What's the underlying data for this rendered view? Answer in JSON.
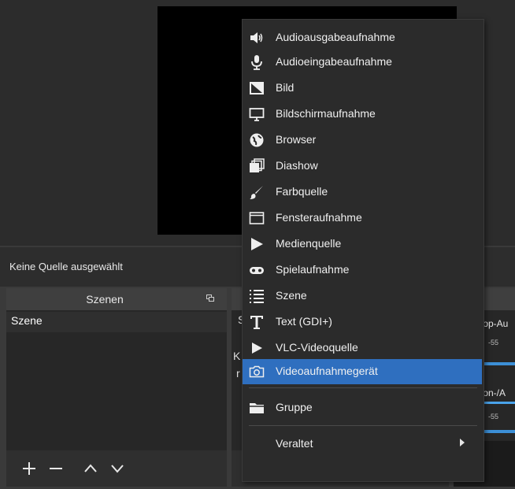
{
  "status": {
    "no_source_selected": "Keine Quelle ausgewählt"
  },
  "scenes": {
    "title": "Szenen",
    "items": [
      "Szene"
    ]
  },
  "sources": {
    "partial_header": "S",
    "partial_line1": "K",
    "partial_line2": "r"
  },
  "mixer": {
    "channels": [
      {
        "label": "top-Au",
        "tick": "-55"
      },
      {
        "label": "fon-/A",
        "tick": "-55"
      }
    ]
  },
  "menu": {
    "items": [
      {
        "label": "Audioausgabeaufnahme",
        "icon": "speaker-icon"
      },
      {
        "label": "Audioeingabeaufnahme",
        "icon": "microphone-icon"
      },
      {
        "label": "Bild",
        "icon": "image-icon"
      },
      {
        "label": "Bildschirmaufnahme",
        "icon": "monitor-icon"
      },
      {
        "label": "Browser",
        "icon": "globe-icon"
      },
      {
        "label": "Diashow",
        "icon": "slideshow-icon"
      },
      {
        "label": "Farbquelle",
        "icon": "brush-icon"
      },
      {
        "label": "Fensteraufnahme",
        "icon": "window-icon"
      },
      {
        "label": "Medienquelle",
        "icon": "play-icon"
      },
      {
        "label": "Spielaufnahme",
        "icon": "gamepad-icon"
      },
      {
        "label": "Szene",
        "icon": "list-icon"
      },
      {
        "label": "Text (GDI+)",
        "icon": "text-icon"
      },
      {
        "label": "VLC-Videoquelle",
        "icon": "play-icon"
      },
      {
        "label": "Videoaufnahmegerät",
        "icon": "camera-icon",
        "selected": true
      },
      {
        "label": "Gruppe",
        "icon": "folder-icon"
      },
      {
        "label": "Veraltet",
        "icon": "",
        "has_submenu": true
      }
    ]
  },
  "colors": {
    "selection": "#2f6fbf",
    "menu_bg": "#2b2b2b",
    "preview": "#000000"
  }
}
